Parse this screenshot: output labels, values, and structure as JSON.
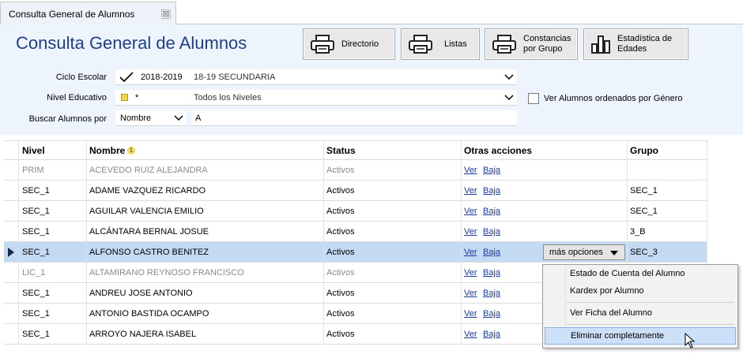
{
  "tab": {
    "label": "Consulta General de Alumnos",
    "close": "⊠"
  },
  "header": {
    "title": "Consulta General de Alumnos"
  },
  "toolbar": {
    "buttons": [
      {
        "label": "Directorio",
        "icon": "printer-icon"
      },
      {
        "label": "Listas",
        "icon": "printer-icon"
      },
      {
        "label": "Constancias\npor Grupo",
        "icon": "printer-icon"
      },
      {
        "label": "Estadística de\nEdades",
        "icon": "bar-chart-icon"
      }
    ]
  },
  "filters": {
    "ciclo": {
      "label": "Ciclo Escolar",
      "code": "2018-2019",
      "value": "18-19 SECUNDARIA"
    },
    "nivel": {
      "label": "Nivel Educativo",
      "code": "*",
      "value": "Todos los Niveles"
    },
    "buscar": {
      "label": "Buscar Alumnos por",
      "field": "Nombre",
      "query": "A"
    },
    "ordenar": {
      "label": "Ver Alumnos ordenados por Género",
      "checked": false
    }
  },
  "grid": {
    "columns": [
      "Nivel",
      "Nombre",
      "Status",
      "Otras acciones",
      "Grupo"
    ],
    "sort_badge": "1",
    "rows": [
      {
        "nivel": "PRIM",
        "nombre": "ACEVEDO RUIZ ALEJANDRA",
        "status": "Activos",
        "ver": "Ver",
        "baja": "Baja",
        "grupo": ""
      },
      {
        "nivel": "SEC_1",
        "nombre": "ADAME VAZQUEZ  RICARDO",
        "status": "Activos",
        "ver": "Ver",
        "baja": "Baja",
        "grupo": "SEC_1"
      },
      {
        "nivel": "SEC_1",
        "nombre": "AGUILAR VALENCIA EMILIO",
        "status": "Activos",
        "ver": "Ver",
        "baja": "Baja",
        "grupo": "SEC_1"
      },
      {
        "nivel": "SEC_1",
        "nombre": "ALCÁNTARA BERNAL JOSUE",
        "status": "Activos",
        "ver": "Ver",
        "baja": "Baja",
        "grupo": "3_B"
      },
      {
        "nivel": "SEC_1",
        "nombre": "ALFONSO CASTRO BENITEZ",
        "status": "Activos",
        "ver": "Ver",
        "baja": "Baja",
        "grupo": "SEC_3"
      },
      {
        "nivel": "LIC_1",
        "nombre": "ALTAMIRANO REYNOSO FRANCISCO",
        "status": "Activos",
        "ver": "Ver",
        "baja": "Baja",
        "grupo": ""
      },
      {
        "nivel": "SEC_1",
        "nombre": "ANDREU  JOSE ANTONIO",
        "status": "Activos",
        "ver": "Ver",
        "baja": "Baja",
        "grupo": ""
      },
      {
        "nivel": "SEC_1",
        "nombre": "ANTONIO BASTIDA OCAMPO",
        "status": "Activos",
        "ver": "Ver",
        "baja": "Baja",
        "grupo": ""
      },
      {
        "nivel": "SEC_1",
        "nombre": "ARROYO NAJERA ISABEL",
        "status": "Activos",
        "ver": "Ver",
        "baja": "Baja",
        "grupo": ""
      }
    ],
    "more_options": "más opciones"
  },
  "context_menu": {
    "items": [
      "Estado de Cuenta del Alumno",
      "Kardex por Alumno",
      "Ver Ficha del Alumno",
      "Eliminar completamente"
    ]
  },
  "colors": {
    "title": "#1f3f8a",
    "panel": "#edf4fc",
    "selected_row": "#c4daf2",
    "link": "#1a3aa0",
    "inactive_text": "#8a8a8a"
  }
}
